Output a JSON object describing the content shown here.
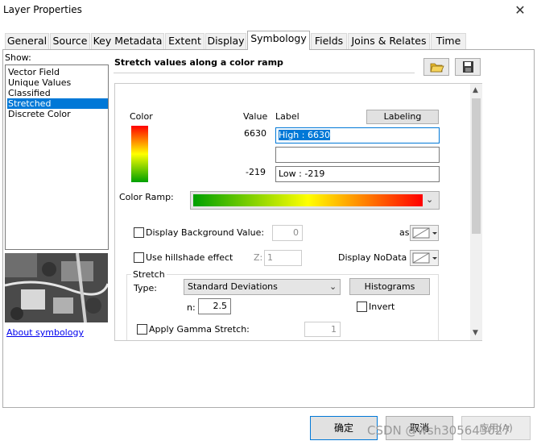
{
  "window": {
    "title": "Layer Properties",
    "close": "✕"
  },
  "tabs": [
    "General",
    "Source",
    "Key Metadata",
    "Extent",
    "Display",
    "Symbology",
    "Fields",
    "Joins & Relates",
    "Time"
  ],
  "active_tab": "Symbology",
  "show_label": "Show:",
  "show_items": [
    "Vector Field",
    "Unique Values",
    "Classified",
    "Stretched",
    "Discrete Color"
  ],
  "selected_show_item": "Stretched",
  "about_link": "About symbology",
  "heading": "Stretch values along a color ramp",
  "colors": {
    "accent": "#0078d7",
    "ramp_high": "#ff0000",
    "ramp_mid": "#ffff00",
    "ramp_low": "#00a000"
  },
  "symbology": {
    "color_header": "Color",
    "value_header": "Value",
    "label_header": "Label",
    "labeling_button": "Labeling",
    "high_value": "6630",
    "high_label": "High : 6630",
    "mid_label": "",
    "low_value": "-219",
    "low_label": "Low : -219",
    "color_ramp_label": "Color Ramp:",
    "display_background_label": "Display Background Value:",
    "background_value": "0",
    "as_label": "as",
    "hillshade_label": "Use hillshade effect",
    "z_label": "Z:",
    "z_value": "1",
    "nodata_label": "Display NoData as",
    "stretch_group": "Stretch",
    "type_label": "Type:",
    "type_value": "Standard Deviations",
    "histograms_button": "Histograms",
    "n_label": "n:",
    "n_value": "2.5",
    "invert_label": "Invert",
    "gamma_label": "Apply Gamma Stretch:",
    "gamma_value": "1"
  },
  "buttons": {
    "ok": "确定",
    "cancel": "取消",
    "apply": "应用(A)"
  },
  "watermark": "CSDN @wsh305643027"
}
